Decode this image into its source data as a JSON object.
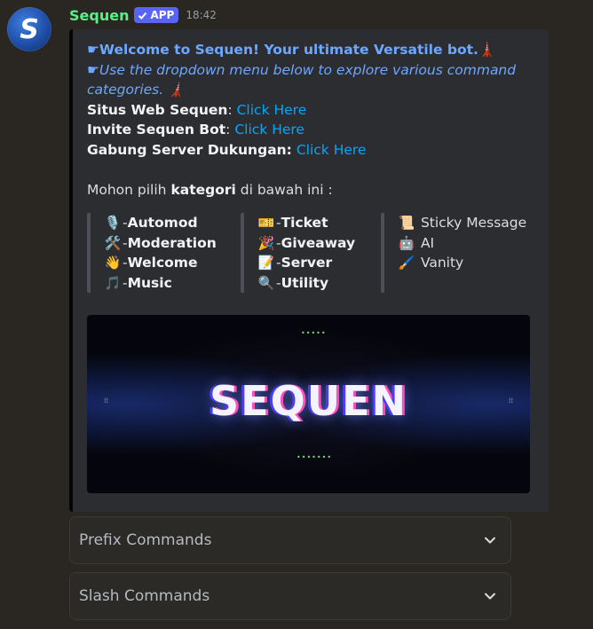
{
  "message": {
    "avatar_letter": "S",
    "username": "Sequen",
    "badge": "APP",
    "timestamp": "18:42"
  },
  "embed": {
    "welcome_prefix": "☛",
    "welcome_text": "Welcome to Sequen! Your ultimate Versatile bot.",
    "welcome_emoji": "🗼",
    "intro_prefix": "☛",
    "intro_text": "Use the dropdown menu below to explore various command categories.",
    "intro_emoji": "🗼",
    "website_label": "Situs Web Sequen",
    "website_link": "Click Here",
    "invite_label": "Invite Sequen Bot",
    "invite_link": "Click Here",
    "support_label": "Gabung Server Dukungan:",
    "support_link": "Click Here",
    "choose_prefix": "Mohon pilih ",
    "choose_bold": "kategori",
    "choose_suffix": " di bawah ini :",
    "categories": [
      [
        {
          "emoji": "🎙️",
          "label": "Automod"
        },
        {
          "emoji": "🛠️",
          "label": "Moderation"
        },
        {
          "emoji": "👋",
          "label": "Welcome"
        },
        {
          "emoji": "🎵",
          "label": "Music"
        }
      ],
      [
        {
          "emoji": "🎫",
          "label": "Ticket"
        },
        {
          "emoji": "🎉",
          "label": "Giveaway"
        },
        {
          "emoji": "📝",
          "label": "Server"
        },
        {
          "emoji": "🔍",
          "label": "Utility"
        }
      ],
      [
        {
          "emoji": "📜",
          "label": "Sticky Message"
        },
        {
          "emoji": "🤖",
          "label": "AI"
        },
        {
          "emoji": "🖌️",
          "label": "Vanity"
        }
      ]
    ],
    "banner_text": "SEQUEN",
    "banner_dots_top": "•••••",
    "banner_dots_bottom": "•••••••",
    "banner_side": "⁞⁞"
  },
  "selects": [
    {
      "placeholder": "Prefix Commands"
    },
    {
      "placeholder": "Slash Commands"
    }
  ],
  "colors": {
    "background": "#2a2622",
    "username": "#57f287",
    "badge": "#5865f2",
    "link": "#00a8fc",
    "embed_bg": "#2b2d31"
  }
}
